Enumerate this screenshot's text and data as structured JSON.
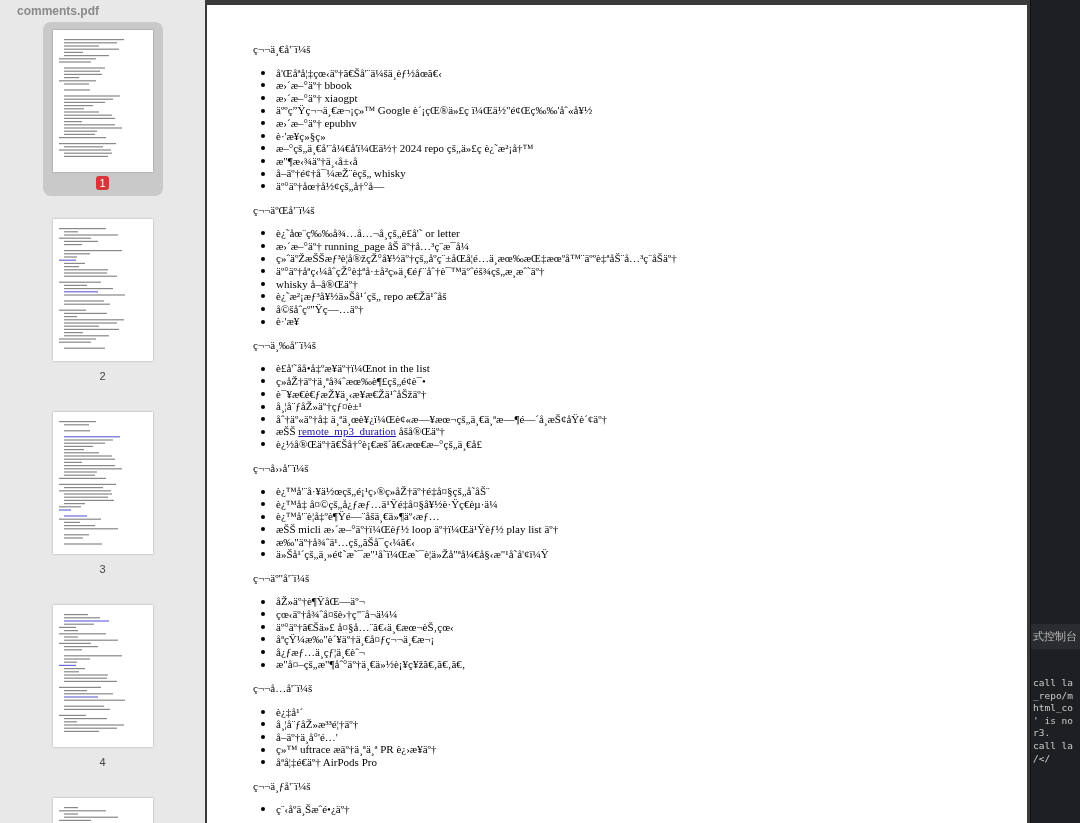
{
  "sidebar": {
    "title": "comments.pdf",
    "thumbnails": [
      {
        "page": "1",
        "selected": true
      },
      {
        "page": "2",
        "selected": false
      },
      {
        "page": "3",
        "selected": false
      },
      {
        "page": "4",
        "selected": false
      },
      {
        "selected": false
      }
    ]
  },
  "document": {
    "sections": [
      {
        "heading": "ç¬¬ä¸€å'¨ï¼š",
        "items": [
          {
            "parts": [
              {
                "text": "å'Œåªå¦‡çœ‹äº†ã€Šå'¨ä¼šä¸èƒ½åœã€‹"
              }
            ]
          },
          {
            "parts": [
              {
                "text": "æ›´æ–°äº† bbook"
              }
            ]
          },
          {
            "parts": [
              {
                "text": "æ›´æ–°äº† xiaogpt"
              }
            ]
          },
          {
            "parts": [
              {
                "text": "äººç”Ÿç¬¬ä¸€æ¬¡ç»™ Google è´¡çŒ®ä»£ç ï¼Œä½\"é¢Œç‰‰'åˆ«å¥½"
              }
            ]
          },
          {
            "parts": [
              {
                "text": "æ›´æ–°äº† epubhv"
              }
            ]
          },
          {
            "parts": [
              {
                "text": "è·'æ¥ç»§ç»"
              }
            ]
          },
          {
            "parts": [
              {
                "text": "æ–°çš„ä¸€å'¨å¼€å'ï¼Œä½† 2024 repo çš„ä»£ç è¿˜æ²¡å†™"
              }
            ]
          },
          {
            "parts": [
              {
                "text": "æ\"¶æ‹¾äº†ä¸‹å±‹å"
              }
            ]
          },
          {
            "parts": [
              {
                "text": "å–äº†é¢†å¯¼æŽ¨èçš„ whisky"
              }
            ]
          },
          {
            "parts": [
              {
                "text": "äº°äº†åœ†å½¢çš„å†°å—"
              }
            ]
          }
        ]
      },
      {
        "heading": "ç¬¬äºŒå'¨ï¼š",
        "items": [
          {
            "parts": [
              {
                "text": "è¿˜åœ¨ç‰‰å¾…å…¬å¸çš„è£å'˜ or letter"
              }
            ]
          },
          {
            "parts": [
              {
                "text": "æ›´æ–°äº† running_page åŠ äº†å…³ç¨æ¯å¼"
              }
            ]
          },
          {
            "parts": [
              {
                "text": "ç»ˆäºŽæŠŠæƒ³è¦å®žçŽ°å¥½äº†çš„åºç¨±åŒå¦é…ä¸æœ‰æŒ‡æœºå™¨äººè‡ªåŠ¨å…³ç¨åŠäº†"
              }
            ]
          },
          {
            "parts": [
              {
                "text": "äº°äº†åªç‹¼åˆçŽ°è‡ªå·±å²ç»ä¸€éƒ¨åˆ†è¯™äºˆéš¾çš„æ¸æˆ˜äº†"
              }
            ]
          },
          {
            "parts": [
              {
                "text": "whisky å–å®Œäº†"
              }
            ]
          },
          {
            "parts": [
              {
                "text": "è¿˜æ²¡æƒ³å¥½ä»Šå¹´çš„ repo æ€Žä¹ˆåš"
              }
            ]
          },
          {
            "parts": [
              {
                "text": "å©šåˆçº\"Ÿç—…äº†"
              }
            ]
          },
          {
            "parts": [
              {
                "text": "è·'æ¥"
              }
            ]
          }
        ]
      },
      {
        "heading": "ç¬¬ä¸‰å'¨ï¼š",
        "items": [
          {
            "parts": [
              {
                "text": "è£å'˜åå•å‡ºæ¥äº†ï¼Œnot in the list"
              }
            ]
          },
          {
            "parts": [
              {
                "text": "ç»åŽ†äº†ä¸ªå¾ˆæœ‰è¶£çš„é¢è¯•"
              }
            ]
          },
          {
            "parts": [
              {
                "text": "è¯¥æ€è€ƒæŽ¥ä¸‹æ¥æ€Žä¹ˆåŠžäº†"
              }
            ]
          },
          {
            "parts": [
              {
                "text": "å¸¦å¨ƒåŽ»äº†çƒ¤è±¹"
              }
            ]
          },
          {
            "parts": [
              {
                "text": "åˆ†äº«äº†å‡ ä¸ªä¸œè¥¿ï¼Œè¢«æ—¥æœ¬çš„ä¸€ä¸ªæ—¶é—´å¸æŠ¢åŸè´¢äº†"
              }
            ]
          },
          {
            "parts": [
              {
                "text": "æŠŠ "
              },
              {
                "text": "remote_mp3_duration",
                "kind": "link"
              },
              {
                "text": " åšå®Œäº†"
              }
            ]
          },
          {
            "parts": [
              {
                "text": "è¿½å®Œäº†ã€Šå†°è¡€æš´ã€‹æœ€æ–°çš„ä¸€å£"
              }
            ]
          }
        ]
      },
      {
        "heading": "ç¬¬å››å'¨ï¼š",
        "items": [
          {
            "parts": [
              {
                "text": "è¿™å'¨å·¥ä½œçš„é¡¹ç›®ç»åŽ†äº†é‡å¤§çš„å˜åŠ¨"
              }
            ]
          },
          {
            "parts": [
              {
                "text": "è¿™å‡ å¤©çš„å¿ƒæƒ…ä¹Ÿé‡å¤§å¥½è·Ÿç€èµ·ä¼"
              }
            ]
          },
          {
            "parts": [
              {
                "text": "è¿™å'¨è¦å‡ºè¶Ÿé—¨åšä¸€ä»¶äº‹æƒ…"
              }
            ]
          },
          {
            "parts": [
              {
                "text": "æŠŠ micli æ›´æ–°äº†ï¼Œèƒ½ loop äº†ï¼Œä¹Ÿèƒ½ play list äº†"
              }
            ]
          },
          {
            "parts": [
              {
                "text": "æ‰\"äº†å¾ˆä¹…çš„ãŠå¯ç‹¼ã€‹"
              }
            ]
          },
          {
            "parts": [
              {
                "text": "ä»Šå¹´çš„ä¸»é¢˜æ˜¯æ\"¹å˜ï¼Œæ˜¯è¦ä»Žå\"ªå¼€å§‹æ\"¹å˜å'¢ï¼Ÿ"
              }
            ]
          }
        ]
      },
      {
        "heading": "ç¬¬äº\"å'¨ï¼š",
        "items": [
          {
            "parts": [
              {
                "text": "åŽ»äº†è¶ŸåŒ—äº¬"
              }
            ]
          },
          {
            "parts": [
              {
                "text": "çœ‹äº†å¾ˆå¤šè›†ç\"¨å¬ä¼¼"
              }
            ]
          },
          {
            "parts": [
              {
                "text": "äº°äº†ã€Šä»£ å¤§å…¨ã€‹ä¸€æœ¬èŠ‚çœ‹"
              }
            ]
          },
          {
            "parts": [
              {
                "text": "åªçŸ¼æ‰\"è´¥äº†ä¸€å¤ƒç¬¬ä¸€æ¬¡"
              }
            ]
          },
          {
            "parts": [
              {
                "text": "å¿ƒæƒ…ä¸çƒ¦ä¸€èˆ¬"
              }
            ]
          },
          {
            "parts": [
              {
                "text": "æ\"å¤–çš„æ\"¶åˆ°äº†ä¸€ä»½è¡¥ç¥žã€‚ã€‚ã€‚"
              }
            ]
          }
        ]
      },
      {
        "heading": "ç¬¬å…­å'¨ï¼š",
        "items": [
          {
            "parts": [
              {
                "text": "è¿‡å¹´"
              }
            ]
          },
          {
            "parts": [
              {
                "text": "å¸¦å¨ƒåŽ»æ³³é¦†äº†"
              }
            ]
          },
          {
            "parts": [
              {
                "text": "å–äº†ä¸å°'é…'"
              }
            ]
          },
          {
            "parts": [
              {
                "text": "ç»™ uftrace æäº†ä¸ªä¸ª PR è¿›æ¥äº†"
              }
            ]
          },
          {
            "parts": [
              {
                "text": "åªå¦‡é€äº† AirPods Pro"
              }
            ]
          }
        ]
      },
      {
        "heading": "ç¬¬ä¸ƒå'¨ï¼š",
        "items": [
          {
            "parts": [
              {
                "text": "ç¨‹åºä¸Šæˆé•¿äº†"
              }
            ]
          }
        ]
      }
    ]
  },
  "side_panel": {
    "tab": "式控制台",
    "lines": [
      "call la",
      "_repo/m",
      "html_co",
      "' is no",
      "r3.",
      "call la",
      "/</"
    ]
  }
}
